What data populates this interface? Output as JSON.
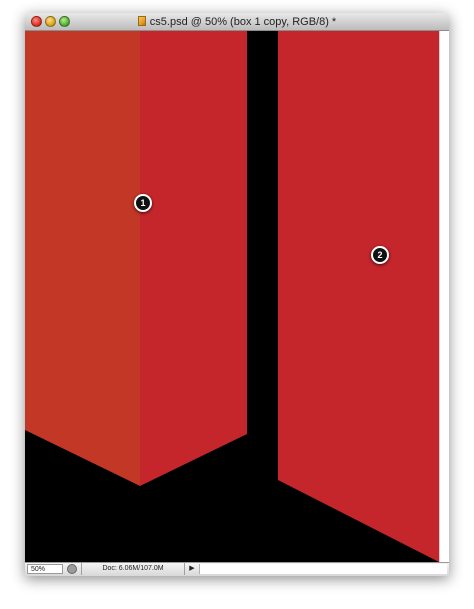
{
  "window": {
    "title": "cs5.psd @ 50% (box 1 copy, RGB/8) *"
  },
  "canvas": {
    "background_color": "#000000",
    "shapes": [
      {
        "name": "box-1-left-half",
        "color": "#c33727"
      },
      {
        "name": "box-1-right-half",
        "color": "#c4262c"
      },
      {
        "name": "box-2",
        "color": "#c4262c"
      }
    ],
    "markers": [
      {
        "label": "1"
      },
      {
        "label": "2"
      }
    ]
  },
  "statusbar": {
    "zoom": "50%",
    "doc_info": "Doc: 6.06M/107.0M",
    "arrow_glyph": "▶"
  },
  "icons": {
    "document": "photoshop-document-icon",
    "status": "status-circle-icon",
    "arrow": "triangle-right-icon"
  }
}
